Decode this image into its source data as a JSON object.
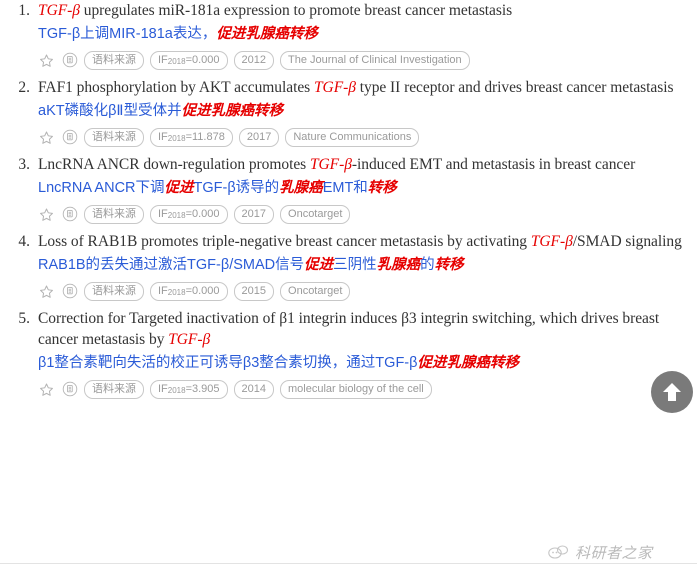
{
  "results": [
    {
      "index": "1.",
      "title_en": [
        {
          "t": "TGF-β",
          "hl": true
        },
        {
          "t": " upregulates miR-181a expression to promote breast cancer metastasis",
          "hl": false
        }
      ],
      "title_cn": [
        {
          "t": "TGF-β上调MIR-181a表达，",
          "hl": false
        },
        {
          "t": "促进乳腺癌转移",
          "hl": true
        }
      ],
      "tags": [
        "语料来源"
      ],
      "if_label": "IF",
      "if_year": "2018",
      "if_value": "=0.000",
      "year": "2012",
      "journal": "The Journal of Clinical Investigation"
    },
    {
      "index": "2.",
      "title_en": [
        {
          "t": "FAF1 phosphorylation by AKT accumulates ",
          "hl": false
        },
        {
          "t": "TGF-β",
          "hl": true
        },
        {
          "t": " type II receptor and drives breast cancer metastasis",
          "hl": false
        }
      ],
      "title_cn": [
        {
          "t": "aKT磷酸化βⅡ型受体并",
          "hl": false
        },
        {
          "t": "促进乳腺癌转移",
          "hl": true
        }
      ],
      "tags": [
        "语料来源"
      ],
      "if_label": "IF",
      "if_year": "2018",
      "if_value": "=11.878",
      "year": "2017",
      "journal": "Nature Communications"
    },
    {
      "index": "3.",
      "title_en": [
        {
          "t": "LncRNA ANCR down-regulation promotes ",
          "hl": false
        },
        {
          "t": "TGF-β",
          "hl": true
        },
        {
          "t": "-induced EMT and metastasis in breast cancer",
          "hl": false
        }
      ],
      "title_cn": [
        {
          "t": "LncRNA ANCR下调",
          "hl": false
        },
        {
          "t": "促进",
          "hl": true
        },
        {
          "t": "TGF-β诱导的",
          "hl": false
        },
        {
          "t": "乳腺癌",
          "hl": true
        },
        {
          "t": "EMT和",
          "hl": false
        },
        {
          "t": "转移",
          "hl": true
        }
      ],
      "tags": [
        "语料来源"
      ],
      "if_label": "IF",
      "if_year": "2018",
      "if_value": "=0.000",
      "year": "2017",
      "journal": "Oncotarget"
    },
    {
      "index": "4.",
      "title_en": [
        {
          "t": "Loss of RAB1B promotes triple-negative breast cancer metastasis by activating ",
          "hl": false
        },
        {
          "t": "TGF-β",
          "hl": true
        },
        {
          "t": "/SMAD signaling",
          "hl": false
        }
      ],
      "title_cn": [
        {
          "t": "RAB1B的丢失通过激活TGF-β/SMAD信号",
          "hl": false
        },
        {
          "t": "促进",
          "hl": true
        },
        {
          "t": "三阴性",
          "hl": false
        },
        {
          "t": "乳腺癌",
          "hl": true
        },
        {
          "t": "的",
          "hl": false
        },
        {
          "t": "转移",
          "hl": true
        }
      ],
      "tags": [
        "语料来源"
      ],
      "if_label": "IF",
      "if_year": "2018",
      "if_value": "=0.000",
      "year": "2015",
      "journal": "Oncotarget"
    },
    {
      "index": "5.",
      "title_en": [
        {
          "t": "Correction for Targeted inactivation of β1 integrin induces β3 integrin switching, which drives breast cancer metastasis by ",
          "hl": false
        },
        {
          "t": "TGF-β",
          "hl": true
        }
      ],
      "title_cn": [
        {
          "t": "β1整合素靶向失活的校正可诱导β3整合素切换，通过TGF-β",
          "hl": false
        },
        {
          "t": "促进乳腺癌转移",
          "hl": true
        }
      ],
      "tags": [
        "语料来源"
      ],
      "if_label": "IF",
      "if_year": "2018",
      "if_value": "=3.905",
      "year": "2014",
      "journal": "molecular biology of the cell"
    }
  ],
  "watermark": {
    "text": "科研者之家"
  },
  "colors": {
    "highlight_red": "#e60000",
    "link_blue": "#2a5bd7",
    "title_dark": "#333333",
    "tag_border": "#c8c8c8",
    "tag_text": "#9a9a9a",
    "scroll_button_bg": "#7a7a7a"
  }
}
